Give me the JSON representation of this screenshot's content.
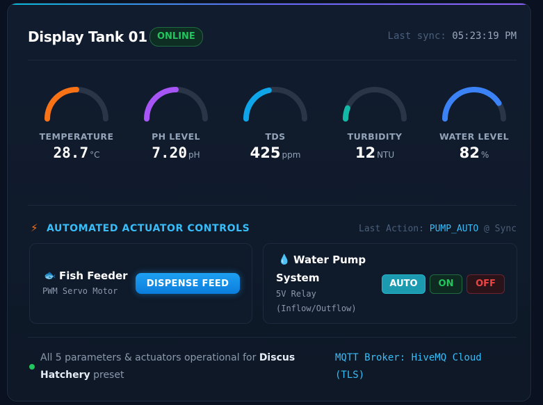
{
  "header": {
    "title": "Display Tank 01",
    "status": "ONLINE",
    "sync_label": "Last sync:",
    "sync_time": "05:23:19 PM"
  },
  "gauges": [
    {
      "label": "TEMPERATURE",
      "value": "28.7",
      "unit": "°C",
      "fill": 0.5,
      "color": "#f97316"
    },
    {
      "label": "PH LEVEL",
      "value": "7.20",
      "unit": "pH",
      "fill": 0.5,
      "color": "#a855f7"
    },
    {
      "label": "TDS",
      "value": "425",
      "unit": "ppm",
      "fill": 0.43,
      "color": "#0ea5e9"
    },
    {
      "label": "TURBIDITY",
      "value": "12",
      "unit": "NTU",
      "fill": 0.12,
      "color": "#14b8a6"
    },
    {
      "label": "WATER LEVEL",
      "value": "82",
      "unit": "%",
      "fill": 0.82,
      "color": "#3b82f6"
    }
  ],
  "controls": {
    "title": "AUTOMATED ACTUATOR CONTROLS",
    "last_action_label": "Last Action:",
    "last_action_value": "PUMP_AUTO",
    "last_action_suffix": "@ Sync",
    "feeder": {
      "icon": "fish-icon",
      "title": "Fish Feeder",
      "subtitle": "PWM Servo Motor",
      "button": "DISPENSE FEED"
    },
    "pump": {
      "icon": "droplet-icon",
      "title_line1": "Water Pump",
      "title_line2": "System",
      "subtitle_line1": "5V Relay",
      "subtitle_line2": "(Inflow/Outflow)",
      "modes": [
        "AUTO",
        "ON",
        "OFF"
      ],
      "active_mode": "AUTO"
    }
  },
  "footer": {
    "text_before": "All 5 parameters & actuators operational for",
    "preset_bold_1": "Discus",
    "preset_bold_2": "Hatchery",
    "text_after": "preset",
    "mqtt_line1": "MQTT Broker: HiveMQ Cloud",
    "mqtt_line2": "(TLS)"
  },
  "colors": {
    "accent": "#38bdf8",
    "online": "#22c55e",
    "off": "#ef4444"
  }
}
